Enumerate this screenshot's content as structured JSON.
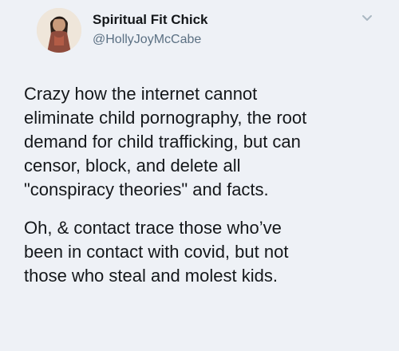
{
  "author": {
    "display_name": "Spiritual Fit Chick",
    "handle": "@HollyJoyMcCabe",
    "avatar_icon": "profile-photo"
  },
  "menu": {
    "icon": "chevron-down-icon"
  },
  "tweet": {
    "paragraphs": [
      {
        "lines": [
          "Crazy how the internet cannot",
          "eliminate child pornography, the root",
          "demand for child trafficking, but can",
          "censor, block, and delete all",
          "\"conspiracy theories\" and facts."
        ]
      },
      {
        "lines": [
          "Oh, & contact trace those who’ve",
          "been in contact with covid, but not",
          "those who steal and molest kids."
        ]
      }
    ]
  }
}
